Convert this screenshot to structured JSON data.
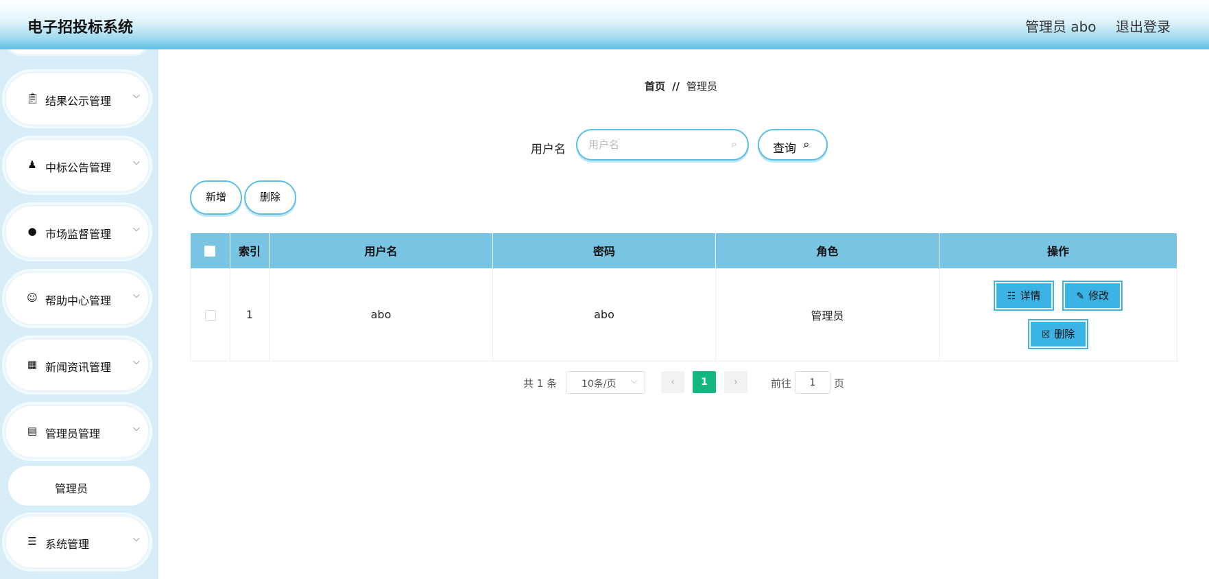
{
  "header": {
    "app_title": "电子招投标系统",
    "user_label": "管理员 abo",
    "logout_label": "退出登录"
  },
  "sidebar": {
    "items": [
      {
        "label": "结果公示管理",
        "icon": "clipboard-icon"
      },
      {
        "label": "中标公告管理",
        "icon": "person-icon"
      },
      {
        "label": "市场监督管理",
        "icon": "bulb-icon"
      },
      {
        "label": "帮助中心管理",
        "icon": "user-icon"
      },
      {
        "label": "新闻资讯管理",
        "icon": "grid-icon"
      },
      {
        "label": "管理员管理",
        "icon": "ticket-icon"
      }
    ],
    "sub_item": "管理员",
    "last_item": {
      "label": "系统管理",
      "icon": "list-icon"
    }
  },
  "breadcrumb": {
    "home": "首页",
    "separator": "//",
    "current": "管理员"
  },
  "search": {
    "label": "用户名",
    "placeholder": "用户名",
    "value": "",
    "query_label": "查询"
  },
  "toolbar": {
    "add_label": "新增",
    "delete_label": "删除"
  },
  "table": {
    "headers": [
      "索引",
      "用户名",
      "密码",
      "角色",
      "操作"
    ],
    "rows": [
      {
        "index": "1",
        "username": "abo",
        "password": "abo",
        "role": "管理员"
      }
    ],
    "actions": {
      "detail": "详情",
      "edit": "修改",
      "delete": "删除"
    }
  },
  "pagination": {
    "total": "共 1 条",
    "page_size": "10条/页",
    "current_page": "1",
    "goto_label": "前往",
    "goto_value": "1",
    "page_suffix": "页"
  },
  "colors": {
    "accent": "#5cbfe6",
    "table_header": "#7ac4e3",
    "action_button": "#3bb3e4",
    "active_page": "#14b87e",
    "sidebar_bg": "#d7eef8"
  }
}
